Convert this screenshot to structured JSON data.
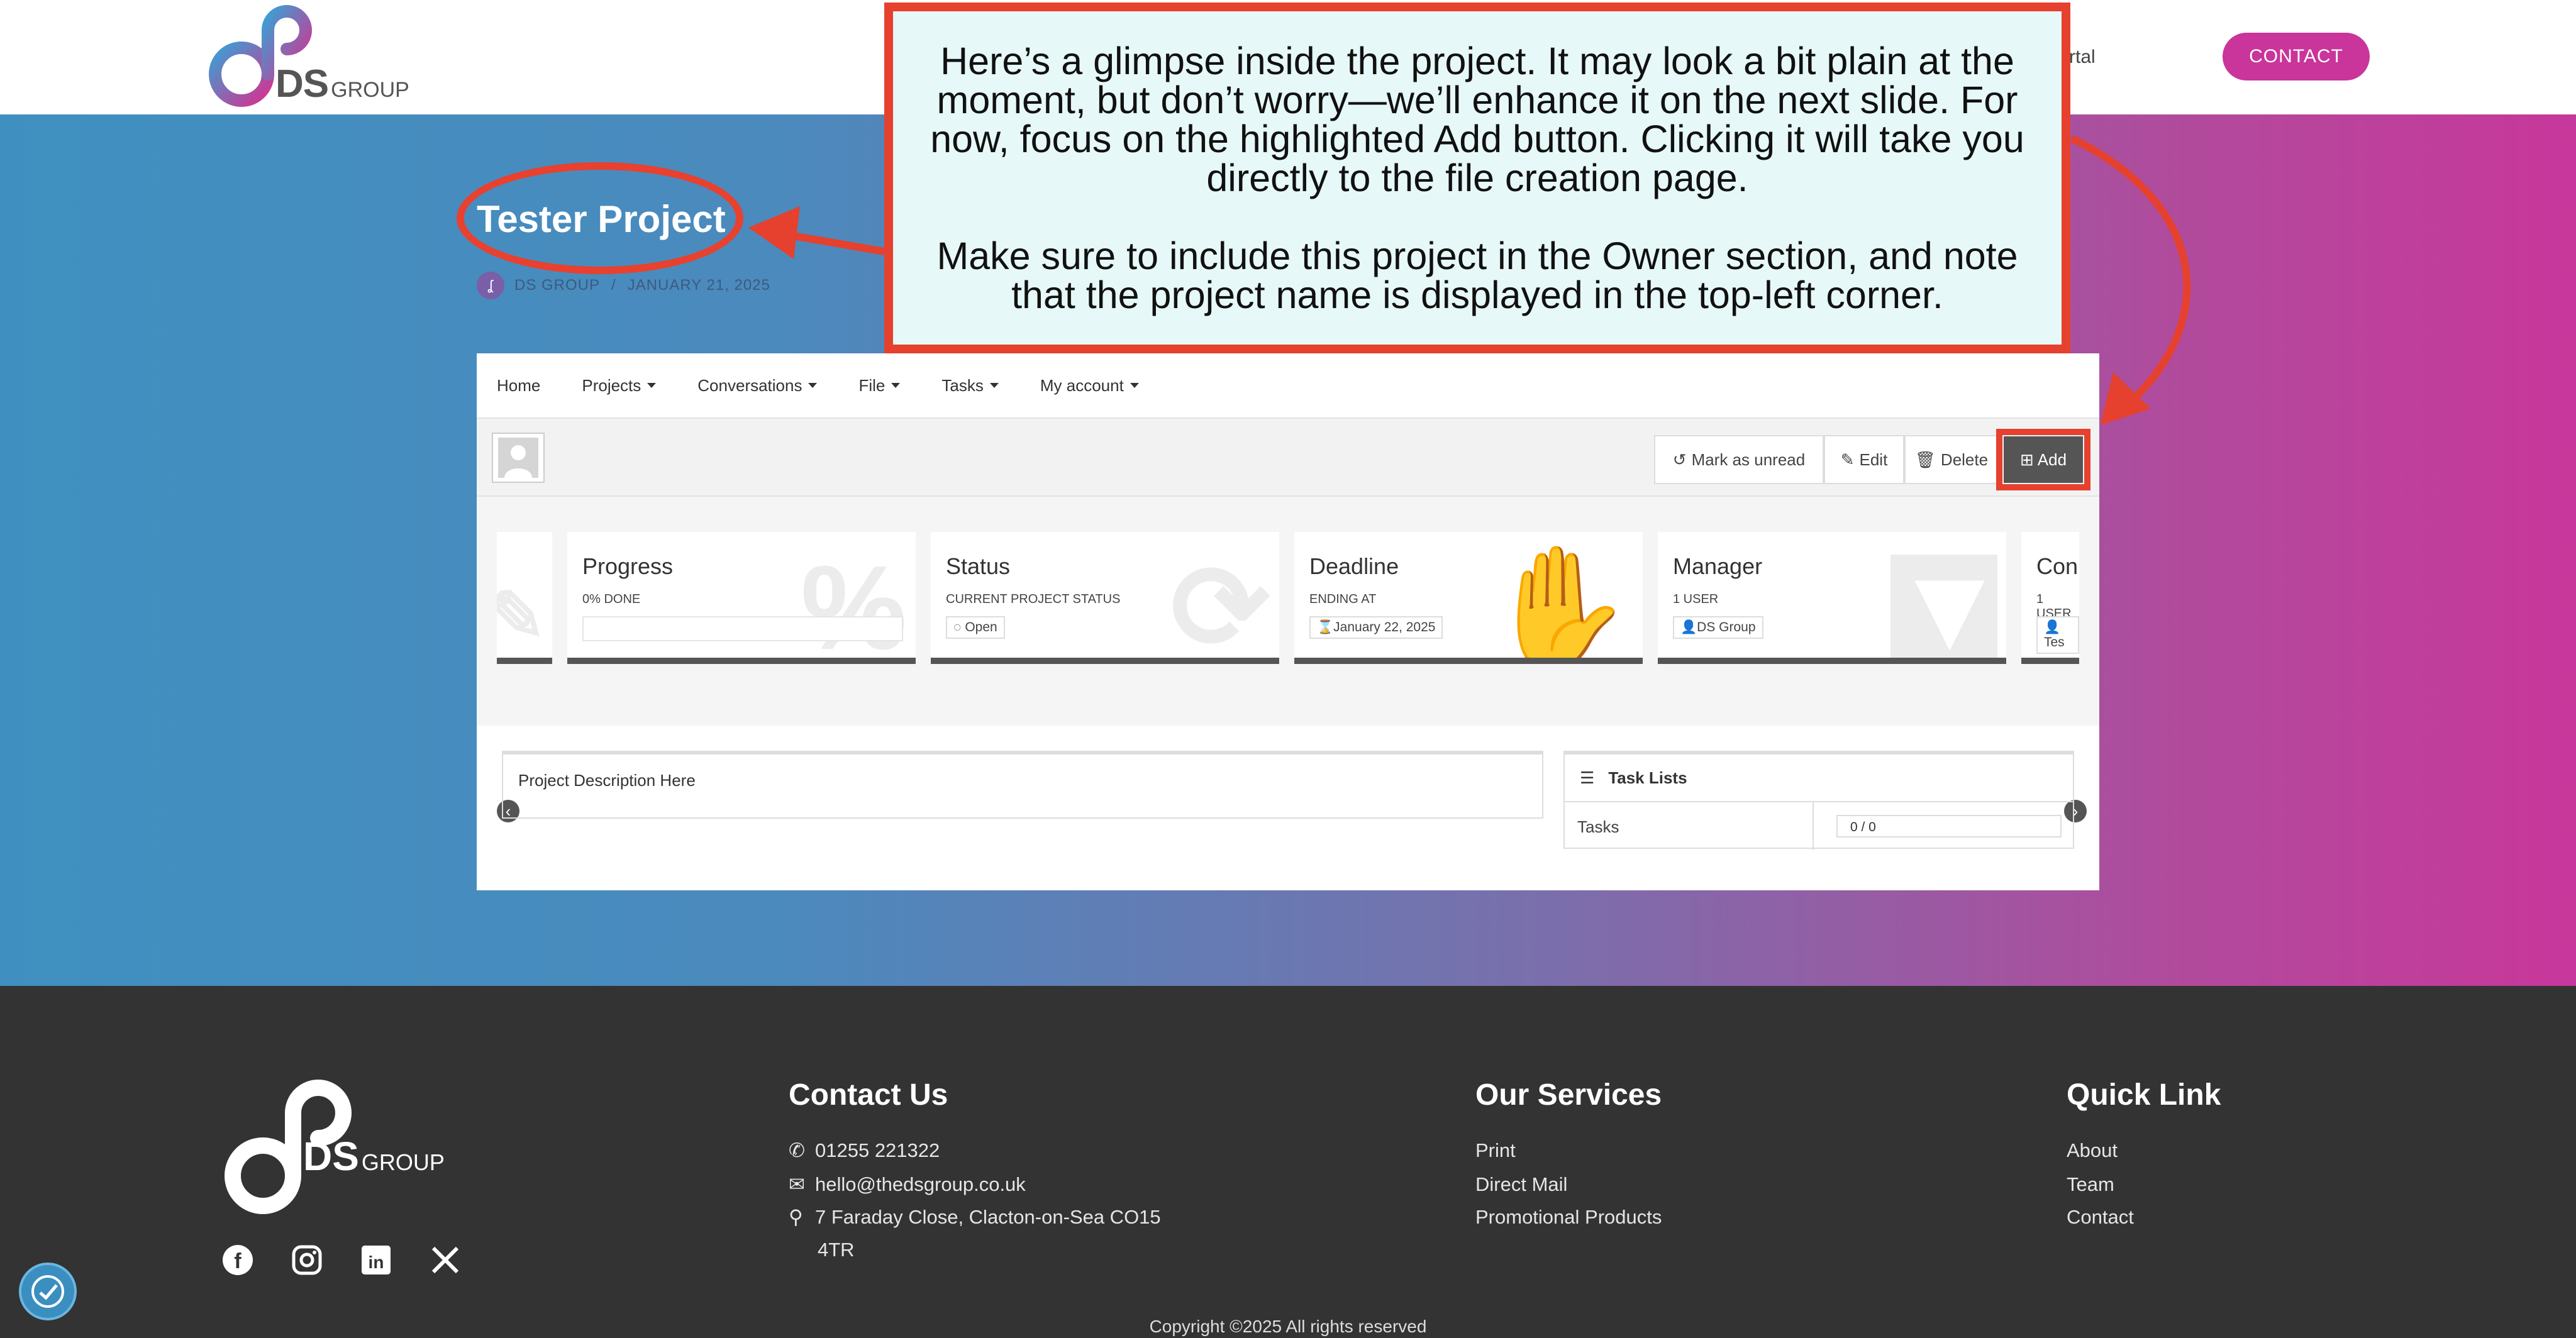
{
  "header": {
    "logo_text": "DS",
    "logo_sub": "GROUP",
    "nav_partial": "rtal",
    "contact_label": "CONTACT"
  },
  "hero": {
    "title": "Tester Project",
    "meta_author": "DS GROUP",
    "meta_sep": "/",
    "meta_date": "JANUARY 21, 2025"
  },
  "callout": {
    "paragraph1": "Here’s a glimpse inside the project. It may look a bit plain at the moment, but don’t worry—we’ll enhance it on the next slide. For now, focus on the highlighted Add button. Clicking it will take you directly to the file creation page.",
    "paragraph2": "Make sure to include this project in the Owner section, and note that the project name is displayed in the top-left corner."
  },
  "menu": {
    "items": [
      "Home",
      "Projects",
      "Conversations",
      "File",
      "Tasks",
      "My account"
    ]
  },
  "toolbar": {
    "mark_unread": "Mark as unread",
    "edit": "Edit",
    "delete": "Delete",
    "add": "Add"
  },
  "cards": {
    "progress": {
      "title": "Progress",
      "sub": "0% DONE",
      "fraction": 0
    },
    "status": {
      "title": "Status",
      "sub": "CURRENT PROJECT STATUS",
      "value": "Open"
    },
    "deadline": {
      "title": "Deadline",
      "sub": "ENDING AT",
      "value": "January 22, 2025"
    },
    "manager": {
      "title": "Manager",
      "sub": "1 USER",
      "value": "DS Group"
    },
    "partial": {
      "title": "Con",
      "sub": "1 USER",
      "value": "Tes"
    }
  },
  "description": "Project Description Here",
  "tasklist": {
    "title": "Task Lists",
    "row_label": "Tasks",
    "row_value": "0 / 0"
  },
  "footer": {
    "logo_text": "DS",
    "logo_sub": "GROUP",
    "contact_title": "Contact Us",
    "phone": "01255 221322",
    "email": "hello@thedsgroup.co.uk",
    "address_line1": "7 Faraday Close, Clacton-on-Sea CO15",
    "address_line2": "4TR",
    "services_title": "Our Services",
    "services": [
      "Print",
      "Direct Mail",
      "Promotional Products"
    ],
    "quick_title": "Quick Link",
    "quick": [
      "About",
      "Team",
      "Contact"
    ],
    "copyright": "Copyright ©2025 All rights reserved"
  },
  "colors": {
    "brand_pink": "#c9359a",
    "brand_blue": "#3f90c0",
    "annotation_red": "#e5412e",
    "callout_bg": "#e6f8f7",
    "footer_bg": "#333333"
  }
}
